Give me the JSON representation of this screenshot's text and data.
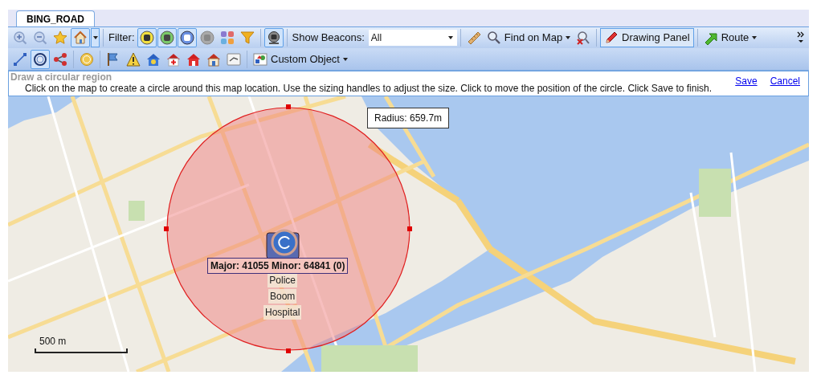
{
  "tab": {
    "label": "BING_ROAD",
    "selected": true
  },
  "toolbar_1": {
    "zoom_buttons": [
      {
        "pressed": false
      },
      {
        "pressed": false
      },
      {
        "pressed": false
      },
      {
        "pressed": true
      }
    ],
    "filter_label": "Filter:",
    "filter_buttons": [
      {
        "pressed": true
      },
      {
        "pressed": true
      },
      {
        "pressed": true
      },
      {
        "pressed": false
      },
      {
        "pressed": false
      },
      {
        "pressed": false
      }
    ],
    "beacon_button": {
      "pressed": true
    },
    "show_beacons_label": "Show Beacons:",
    "show_beacons_value": "All",
    "find_on_map": "Find on Map",
    "drawing_panel": {
      "label": "Drawing Panel",
      "pressed": true
    },
    "route": "Route"
  },
  "toolbar_2": {
    "draw_tools": [
      {
        "pressed": false
      },
      {
        "pressed": true
      },
      {
        "pressed": false
      }
    ],
    "custom_object": "Custom Object"
  },
  "instructions": {
    "title": "Draw a circular region",
    "text": "Click on the map to create a circle around this map location. Use the sizing handles to adjust the size. Click to move the position of the circle. Click Save to finish.",
    "links": [
      "Save",
      "Cancel"
    ]
  },
  "map": {
    "radius_label": "Radius: 659.7m",
    "beacon_label": "Major: 41055 Minor: 64841 (0)",
    "place_labels": [
      "Police",
      "Boom",
      "Hospital"
    ],
    "scale_label": "500 m"
  }
}
